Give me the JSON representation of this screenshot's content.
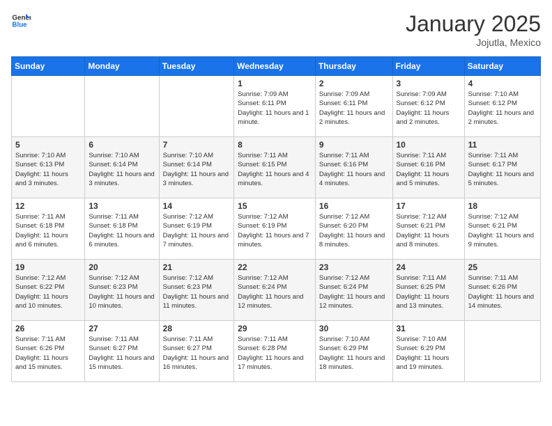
{
  "logo": {
    "general": "General",
    "blue": "Blue"
  },
  "title": "January 2025",
  "subtitle": "Jojutla, Mexico",
  "headers": [
    "Sunday",
    "Monday",
    "Tuesday",
    "Wednesday",
    "Thursday",
    "Friday",
    "Saturday"
  ],
  "weeks": [
    [
      {
        "day": "",
        "sunrise": "",
        "sunset": "",
        "daylight": ""
      },
      {
        "day": "",
        "sunrise": "",
        "sunset": "",
        "daylight": ""
      },
      {
        "day": "",
        "sunrise": "",
        "sunset": "",
        "daylight": ""
      },
      {
        "day": "1",
        "sunrise": "Sunrise: 7:09 AM",
        "sunset": "Sunset: 6:11 PM",
        "daylight": "Daylight: 11 hours and 1 minute."
      },
      {
        "day": "2",
        "sunrise": "Sunrise: 7:09 AM",
        "sunset": "Sunset: 6:11 PM",
        "daylight": "Daylight: 11 hours and 2 minutes."
      },
      {
        "day": "3",
        "sunrise": "Sunrise: 7:09 AM",
        "sunset": "Sunset: 6:12 PM",
        "daylight": "Daylight: 11 hours and 2 minutes."
      },
      {
        "day": "4",
        "sunrise": "Sunrise: 7:10 AM",
        "sunset": "Sunset: 6:12 PM",
        "daylight": "Daylight: 11 hours and 2 minutes."
      }
    ],
    [
      {
        "day": "5",
        "sunrise": "Sunrise: 7:10 AM",
        "sunset": "Sunset: 6:13 PM",
        "daylight": "Daylight: 11 hours and 3 minutes."
      },
      {
        "day": "6",
        "sunrise": "Sunrise: 7:10 AM",
        "sunset": "Sunset: 6:14 PM",
        "daylight": "Daylight: 11 hours and 3 minutes."
      },
      {
        "day": "7",
        "sunrise": "Sunrise: 7:10 AM",
        "sunset": "Sunset: 6:14 PM",
        "daylight": "Daylight: 11 hours and 3 minutes."
      },
      {
        "day": "8",
        "sunrise": "Sunrise: 7:11 AM",
        "sunset": "Sunset: 6:15 PM",
        "daylight": "Daylight: 11 hours and 4 minutes."
      },
      {
        "day": "9",
        "sunrise": "Sunrise: 7:11 AM",
        "sunset": "Sunset: 6:16 PM",
        "daylight": "Daylight: 11 hours and 4 minutes."
      },
      {
        "day": "10",
        "sunrise": "Sunrise: 7:11 AM",
        "sunset": "Sunset: 6:16 PM",
        "daylight": "Daylight: 11 hours and 5 minutes."
      },
      {
        "day": "11",
        "sunrise": "Sunrise: 7:11 AM",
        "sunset": "Sunset: 6:17 PM",
        "daylight": "Daylight: 11 hours and 5 minutes."
      }
    ],
    [
      {
        "day": "12",
        "sunrise": "Sunrise: 7:11 AM",
        "sunset": "Sunset: 6:18 PM",
        "daylight": "Daylight: 11 hours and 6 minutes."
      },
      {
        "day": "13",
        "sunrise": "Sunrise: 7:11 AM",
        "sunset": "Sunset: 6:18 PM",
        "daylight": "Daylight: 11 hours and 6 minutes."
      },
      {
        "day": "14",
        "sunrise": "Sunrise: 7:12 AM",
        "sunset": "Sunset: 6:19 PM",
        "daylight": "Daylight: 11 hours and 7 minutes."
      },
      {
        "day": "15",
        "sunrise": "Sunrise: 7:12 AM",
        "sunset": "Sunset: 6:19 PM",
        "daylight": "Daylight: 11 hours and 7 minutes."
      },
      {
        "day": "16",
        "sunrise": "Sunrise: 7:12 AM",
        "sunset": "Sunset: 6:20 PM",
        "daylight": "Daylight: 11 hours and 8 minutes."
      },
      {
        "day": "17",
        "sunrise": "Sunrise: 7:12 AM",
        "sunset": "Sunset: 6:21 PM",
        "daylight": "Daylight: 11 hours and 8 minutes."
      },
      {
        "day": "18",
        "sunrise": "Sunrise: 7:12 AM",
        "sunset": "Sunset: 6:21 PM",
        "daylight": "Daylight: 11 hours and 9 minutes."
      }
    ],
    [
      {
        "day": "19",
        "sunrise": "Sunrise: 7:12 AM",
        "sunset": "Sunset: 6:22 PM",
        "daylight": "Daylight: 11 hours and 10 minutes."
      },
      {
        "day": "20",
        "sunrise": "Sunrise: 7:12 AM",
        "sunset": "Sunset: 6:23 PM",
        "daylight": "Daylight: 11 hours and 10 minutes."
      },
      {
        "day": "21",
        "sunrise": "Sunrise: 7:12 AM",
        "sunset": "Sunset: 6:23 PM",
        "daylight": "Daylight: 11 hours and 11 minutes."
      },
      {
        "day": "22",
        "sunrise": "Sunrise: 7:12 AM",
        "sunset": "Sunset: 6:24 PM",
        "daylight": "Daylight: 11 hours and 12 minutes."
      },
      {
        "day": "23",
        "sunrise": "Sunrise: 7:12 AM",
        "sunset": "Sunset: 6:24 PM",
        "daylight": "Daylight: 11 hours and 12 minutes."
      },
      {
        "day": "24",
        "sunrise": "Sunrise: 7:11 AM",
        "sunset": "Sunset: 6:25 PM",
        "daylight": "Daylight: 11 hours and 13 minutes."
      },
      {
        "day": "25",
        "sunrise": "Sunrise: 7:11 AM",
        "sunset": "Sunset: 6:26 PM",
        "daylight": "Daylight: 11 hours and 14 minutes."
      }
    ],
    [
      {
        "day": "26",
        "sunrise": "Sunrise: 7:11 AM",
        "sunset": "Sunset: 6:26 PM",
        "daylight": "Daylight: 11 hours and 15 minutes."
      },
      {
        "day": "27",
        "sunrise": "Sunrise: 7:11 AM",
        "sunset": "Sunset: 6:27 PM",
        "daylight": "Daylight: 11 hours and 15 minutes."
      },
      {
        "day": "28",
        "sunrise": "Sunrise: 7:11 AM",
        "sunset": "Sunset: 6:27 PM",
        "daylight": "Daylight: 11 hours and 16 minutes."
      },
      {
        "day": "29",
        "sunrise": "Sunrise: 7:11 AM",
        "sunset": "Sunset: 6:28 PM",
        "daylight": "Daylight: 11 hours and 17 minutes."
      },
      {
        "day": "30",
        "sunrise": "Sunrise: 7:10 AM",
        "sunset": "Sunset: 6:29 PM",
        "daylight": "Daylight: 11 hours and 18 minutes."
      },
      {
        "day": "31",
        "sunrise": "Sunrise: 7:10 AM",
        "sunset": "Sunset: 6:29 PM",
        "daylight": "Daylight: 11 hours and 19 minutes."
      },
      {
        "day": "",
        "sunrise": "",
        "sunset": "",
        "daylight": ""
      }
    ]
  ]
}
